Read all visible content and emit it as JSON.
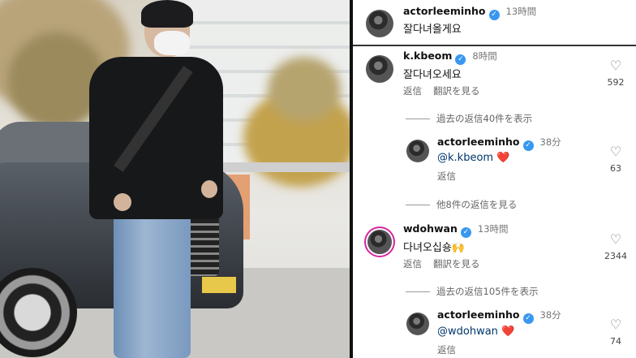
{
  "comments": {
    "c1": {
      "username": "actorleeminho",
      "time": "13時間",
      "text": "잘다녀올게요"
    },
    "c2": {
      "username": "k.kbeom",
      "time": "8時間",
      "text": "잘다녀오세요",
      "reply": "返信",
      "translate": "翻訳を見る",
      "likes": "592"
    },
    "c2_more": "過去の返信40件を表示",
    "c3": {
      "username": "actorleeminho",
      "time": "38分",
      "mention": "@k.kbeom",
      "heart": "❤️",
      "reply": "返信",
      "likes": "63"
    },
    "c3_more": "他8件の返信を見る",
    "c4": {
      "username": "wdohwan",
      "time": "13時間",
      "text": "다녀오십숑🙌",
      "reply": "返信",
      "translate": "翻訳を見る",
      "likes": "2344"
    },
    "c4_more": "過去の返信105件を表示",
    "c5": {
      "username": "actorleeminho",
      "time": "38分",
      "mention": "@wdohwan",
      "heart": "❤️",
      "reply": "返信",
      "likes": "74"
    }
  },
  "icons": {
    "verified": "verified-check-icon",
    "heart": "heart-outline-icon"
  },
  "colors": {
    "verified": "#3897f0",
    "mention": "#00376b",
    "heart_red": "#ed4956"
  }
}
